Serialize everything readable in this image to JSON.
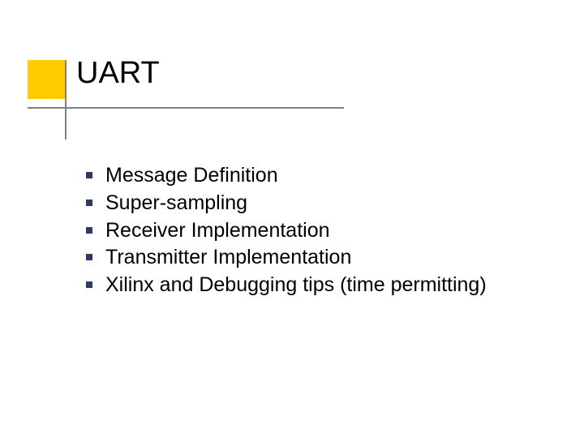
{
  "title": "UART",
  "bullets": [
    "Message Definition",
    "Super-sampling",
    "Receiver Implementation",
    "Transmitter Implementation",
    "Xilinx and Debugging tips (time permitting)"
  ],
  "colors": {
    "accent": "#ffcc00",
    "bullet": "#2e3a66",
    "rule": "#808080"
  }
}
